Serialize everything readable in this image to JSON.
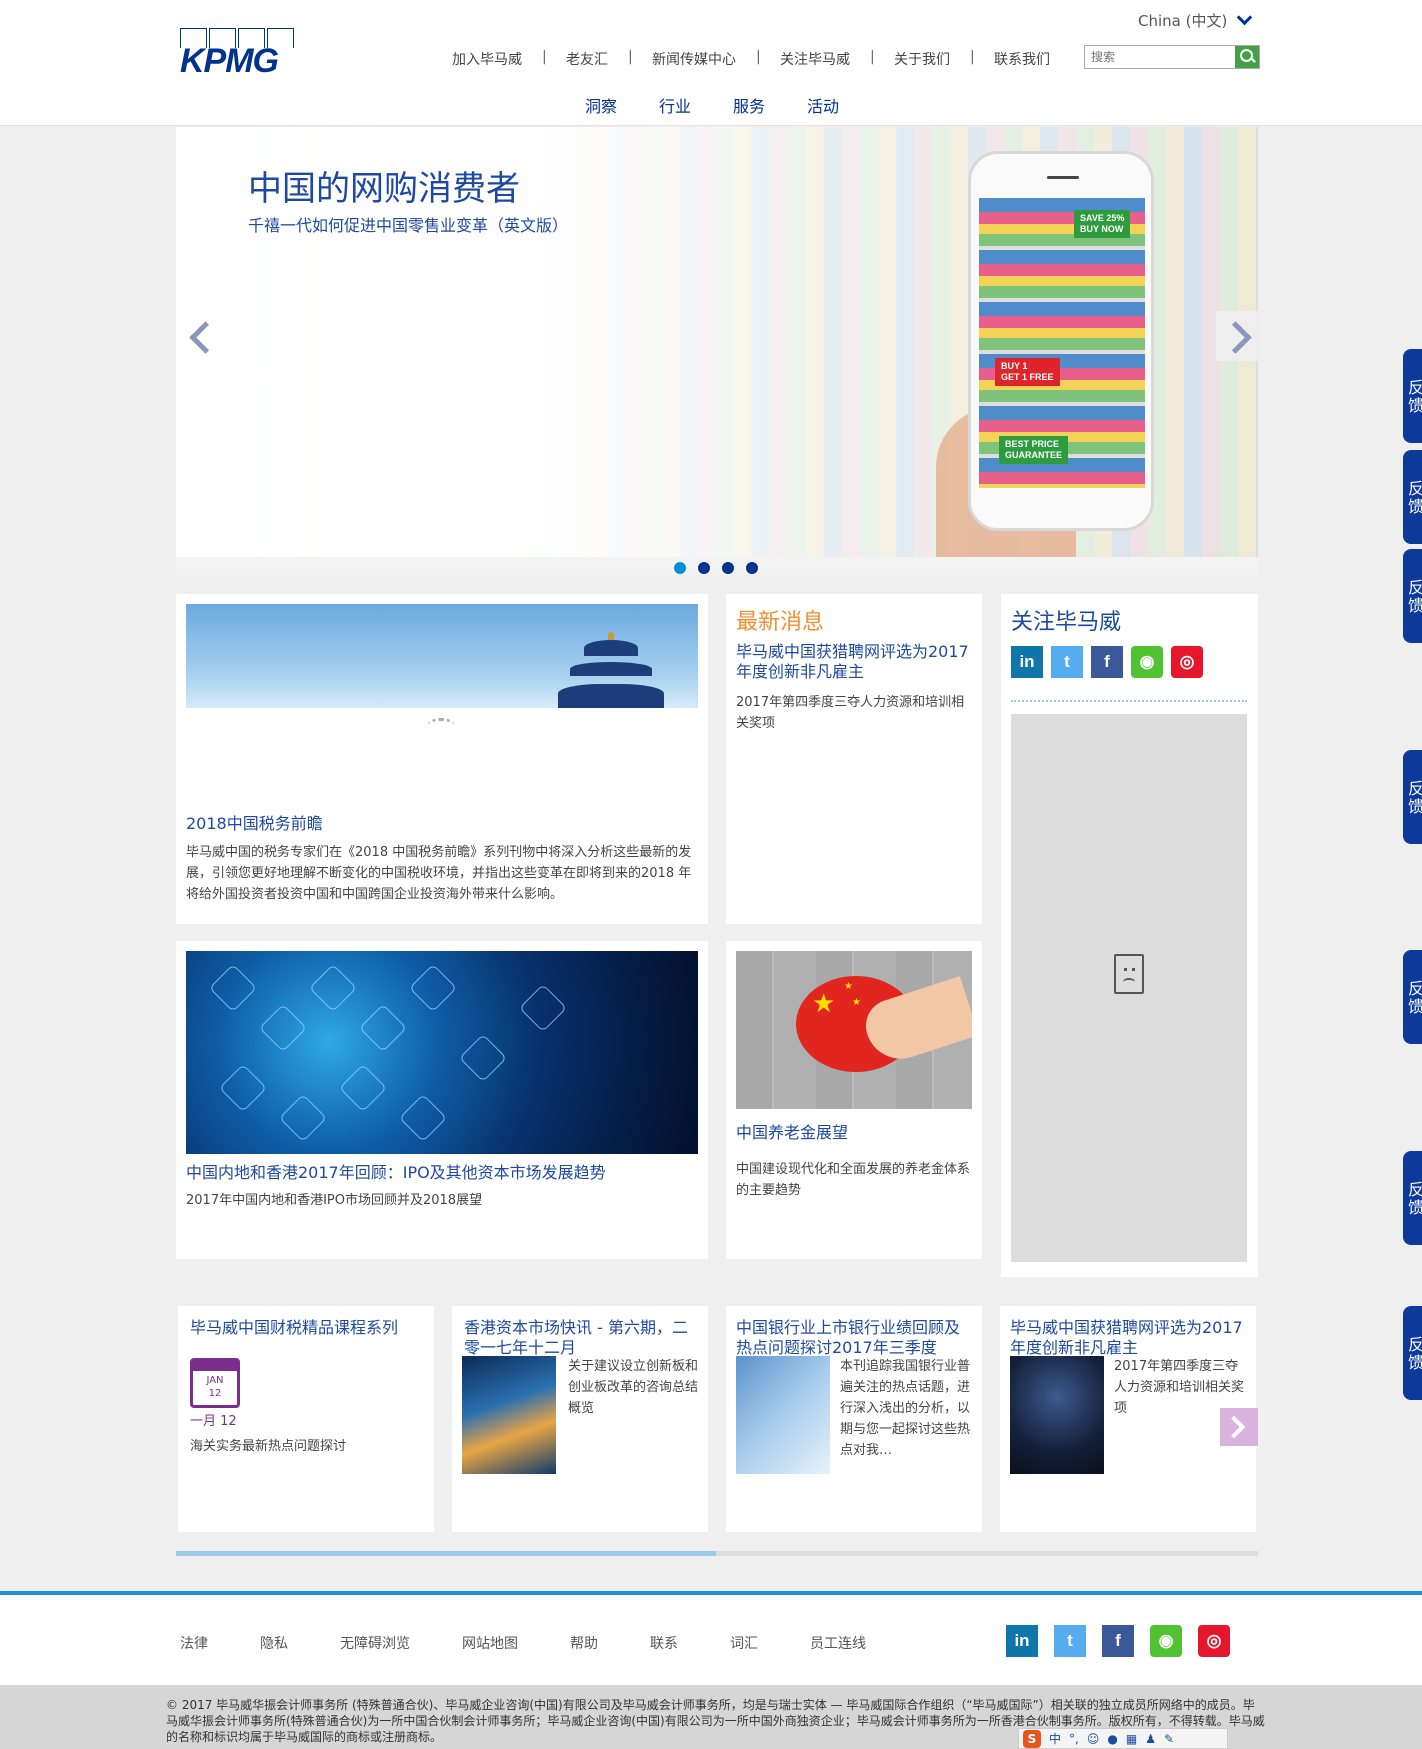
{
  "header": {
    "logo_text": "KPMG",
    "language": "China (中文)",
    "top_nav": [
      "加入毕马威",
      "老友汇",
      "新闻传媒中心",
      "关注毕马威",
      "关于我们",
      "联系我们"
    ],
    "search_placeholder": "搜索",
    "main_nav": [
      "洞察",
      "行业",
      "服务",
      "活动"
    ]
  },
  "hero": {
    "title": "中国的网购消费者",
    "subtitle": "千禧一代如何促进中国零售业变革（英文版）",
    "phone_tags": [
      "SAVE 25%\nBUY NOW",
      "BUY 1\nGET 1 FREE",
      "BEST PRICE\nGUARANTEE"
    ],
    "slide_count": 4,
    "active_slide": 1
  },
  "feature_tax": {
    "title": "2018中国税务前瞻",
    "body": "毕马威中国的税务专家们在《2018 中国税务前瞻》系列刊物中将深入分析这些最新的发展，引领您更好地理解不断变化的中国税收环境，并指出这些变革在即将到来的2018 年将给外国投资者投资中国和中国跨国企业投资海外带来什么影响。"
  },
  "latest_news": {
    "heading": "最新消息",
    "title": "毕马威中国获猎聘网评选为2017年度创新非凡雇主",
    "body": "2017年第四季度三夺人力资源和培训相关奖项"
  },
  "follow": {
    "heading": "关注毕马威",
    "icons": [
      "linkedin-icon",
      "twitter-icon",
      "facebook-icon",
      "wechat-icon",
      "weibo-icon"
    ]
  },
  "feature_ipo": {
    "title": "中国内地和香港2017年回顾：IPO及其他资本市场发展趋势",
    "body": "2017年中国内地和香港IPO市场回顾并及2018展望"
  },
  "feature_pension": {
    "title": "中国养老金展望",
    "body": "中国建设现代化和全面发展的养老金体系的主要趋势"
  },
  "events": [
    {
      "title": "毕马威中国财税精品课程系列",
      "cal_month": "JAN",
      "cal_day": "12",
      "date": "一月 12",
      "body": "海关实务最新热点问题探讨"
    },
    {
      "title": "香港资本市场快讯 - 第六期，二零一七年十二月",
      "body": "关于建议设立创新板和创业板改革的咨询总结概览"
    },
    {
      "title": "中国银行业上市银行业绩回顾及热点问题探讨2017年三季度",
      "body": "本刊追踪我国银行业普遍关注的热点话题，进行深入浅出的分析，以期与您一起探讨这些热点对我…"
    },
    {
      "title": "毕马威中国获猎聘网评选为2017年度创新非凡雇主",
      "body": "2017年第四季度三夺人力资源和培训相关奖项"
    }
  ],
  "carousel_progress": 0.5,
  "footer": {
    "links": [
      "法律",
      "隐私",
      "无障碍浏览",
      "网站地图",
      "帮助",
      "联系",
      "词汇",
      "员工连线"
    ],
    "copyright": "© 2017 毕马威华振会计师事务所 (特殊普通合伙)、毕马威企业咨询(中国)有限公司及毕马威会计师事务所，均是与瑞士实体 — 毕马威国际合作组织（“毕马威国际”）相关联的独立成员所网络中的成员。毕马威华振会计师事务所(特殊普通合伙)为一所中国合伙制会计师事务所；毕马威企业咨询(中国)有限公司为一所中国外商独资企业；毕马威会计师事务所为一所香港合伙制事务所。版权所有，不得转载。毕马威的名称和标识均属于毕马威国际的商标或注册商标。"
  },
  "ime_bar": {
    "mode": "中"
  },
  "feedback_label": "反馈",
  "colors": {
    "brand": "#00338d",
    "link": "#1e49a3",
    "news_orange": "#f68d2e",
    "footer_blue": "#1c93d6",
    "search_green": "#43a047"
  }
}
